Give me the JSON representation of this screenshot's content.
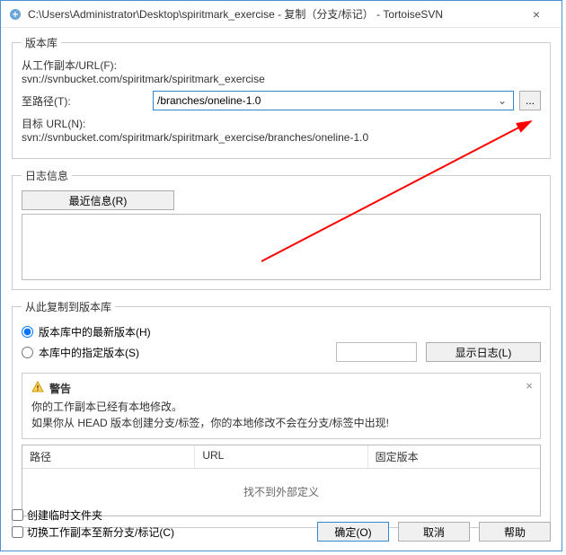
{
  "window": {
    "title": "C:\\Users\\Administrator\\Desktop\\spiritmark_exercise - 复制（分支/标记） - TortoiseSVN",
    "close": "×"
  },
  "repo_group": {
    "legend": "版本库",
    "from_label": "从工作副本/URL(F):",
    "from_url": "svn://svnbucket.com/spiritmark/spiritmark_exercise",
    "to_path_label": "至路径(T):",
    "to_path_value": "/branches/oneline-1.0",
    "dots": "...",
    "target_label": "目标 URL(N):",
    "target_url": "svn://svnbucket.com/spiritmark/spiritmark_exercise/branches/oneline-1.0"
  },
  "log_group": {
    "legend": "日志信息",
    "recent_button": "最近信息(R)"
  },
  "copy_group": {
    "legend": "从此复制到版本库",
    "radio_head": "版本库中的最新版本(H)",
    "radio_specific": "本库中的指定版本(S)",
    "show_log": "显示日志(L)",
    "warning": {
      "title": "警告",
      "line1": "你的工作副本已经有本地修改。",
      "line2": "如果你从 HEAD 版本创建分支/标签，你的本地修改不会在分支/标签中出现!",
      "close": "×"
    },
    "table": {
      "col_path": "路径",
      "col_url": "URL",
      "col_rev": "固定版本",
      "empty": "找不到外部定义"
    }
  },
  "footer": {
    "chk_temp": "创建临时文件夹",
    "chk_switch": "切换工作副本至新分支/标记(C)",
    "ok": "确定(O)",
    "cancel": "取消",
    "help": "帮助"
  }
}
